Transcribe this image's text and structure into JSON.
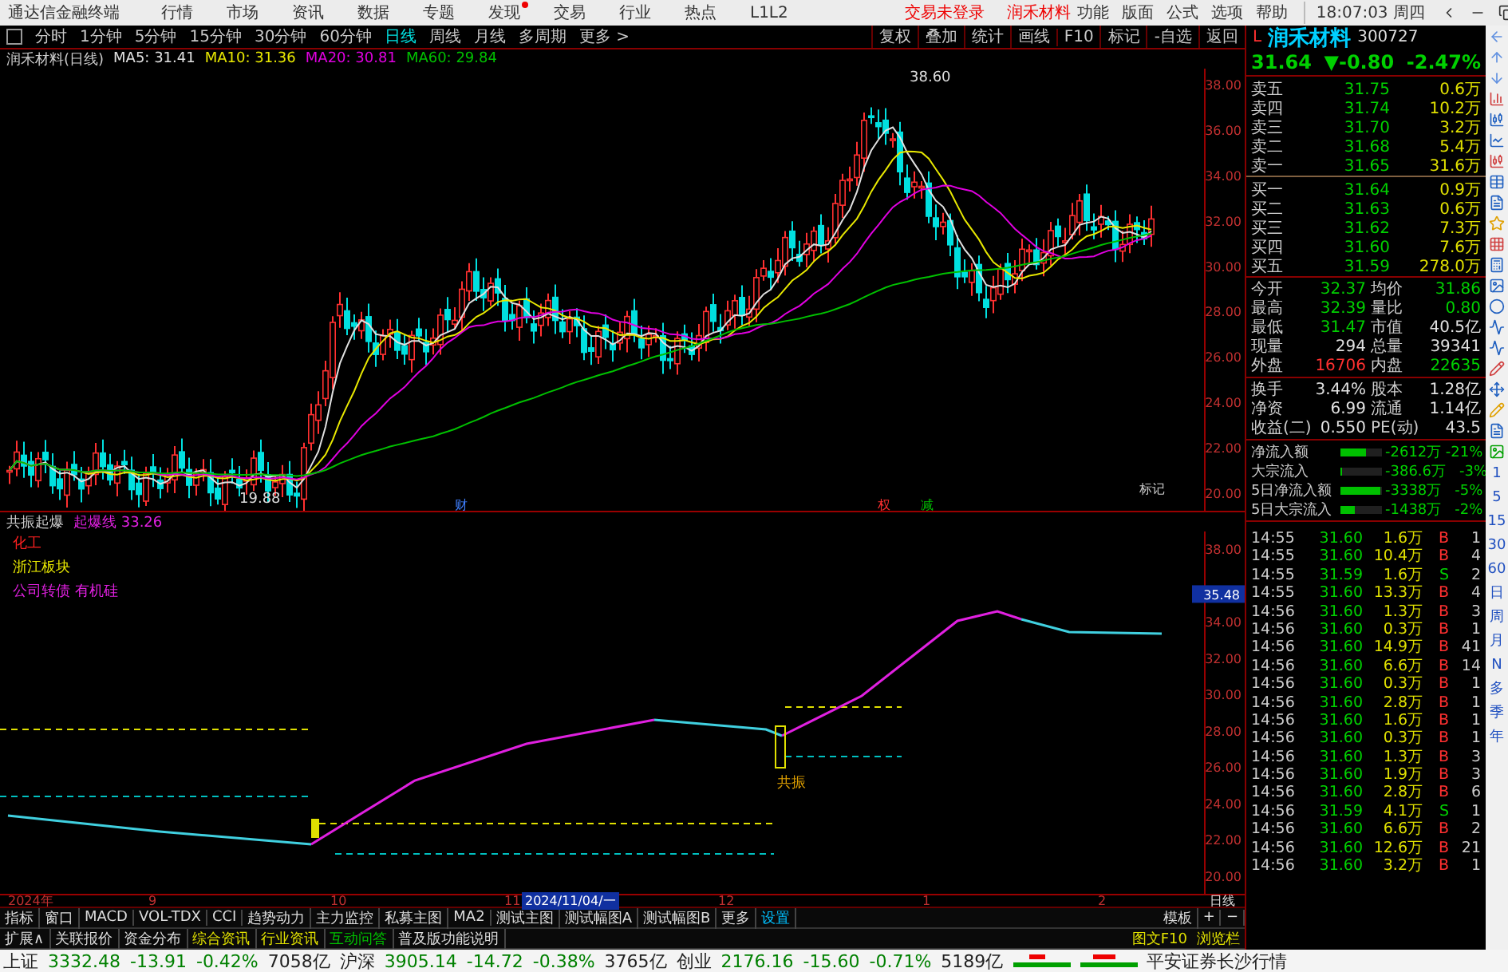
{
  "menu_bar": {
    "app_title": "通达信金融终端",
    "menus": [
      {
        "label": "行情",
        "dot": false
      },
      {
        "label": "市场",
        "dot": false
      },
      {
        "label": "资讯",
        "dot": false
      },
      {
        "label": "数据",
        "dot": false
      },
      {
        "label": "专题",
        "dot": false
      },
      {
        "label": "发现",
        "dot": true
      },
      {
        "label": "交易",
        "dot": false
      },
      {
        "label": "行业",
        "dot": false
      },
      {
        "label": "热点",
        "dot": false
      },
      {
        "label": "L1L2",
        "dot": false
      }
    ],
    "notices": [
      "交易未登录",
      "润禾材料"
    ],
    "tools": [
      "功能",
      "版面",
      "公式",
      "选项",
      "帮助"
    ],
    "clock": "18:07:03 周四"
  },
  "period_tabs": [
    {
      "label": "分时",
      "selected": false
    },
    {
      "label": "1分钟",
      "selected": false
    },
    {
      "label": "5分钟",
      "selected": false
    },
    {
      "label": "15分钟",
      "selected": false
    },
    {
      "label": "30分钟",
      "selected": false
    },
    {
      "label": "60分钟",
      "selected": false
    },
    {
      "label": "日线",
      "selected": true
    },
    {
      "label": "周线",
      "selected": false
    },
    {
      "label": "月线",
      "selected": false
    },
    {
      "label": "多周期",
      "selected": false
    },
    {
      "label": "更多 >",
      "selected": false
    }
  ],
  "chart_tools": [
    "复权",
    "叠加",
    "统计",
    "画线",
    "F10",
    "标记",
    "-自选",
    "返回"
  ],
  "main_chart": {
    "title": "润禾材料(日线)",
    "ma": [
      {
        "label": "MA5: 31.41",
        "color": "#e0e0e0"
      },
      {
        "label": "MA10: 31.36",
        "color": "#e8e800"
      },
      {
        "label": "MA20: 30.81",
        "color": "#e000e0"
      },
      {
        "label": "MA60: 29.84",
        "color": "#00c000"
      }
    ],
    "y_axis": [
      "38.00",
      "36.00",
      "34.00",
      "32.00",
      "30.00",
      "28.00",
      "26.00",
      "24.00",
      "22.00",
      "20.00"
    ],
    "high_label": "38.60",
    "low_label": "19.88",
    "marks": [
      {
        "text": "财",
        "color": "#4080ff"
      },
      {
        "text": "权",
        "color": "#ff3030"
      },
      {
        "text": "减",
        "color": "#00c000"
      }
    ],
    "tag": "标记"
  },
  "indicator": {
    "title": "共振起爆",
    "line_label": "起爆线 33.26",
    "notes": [
      {
        "text": "化工",
        "color": "#ff2020"
      },
      {
        "text": "浙江板块",
        "color": "#e8e800"
      },
      {
        "text": "公司转债 有机硅",
        "color": "#e020e0"
      }
    ],
    "signal_label": "共振",
    "y_axis": [
      "38.00",
      "34.00",
      "32.00",
      "30.00",
      "28.00",
      "26.00",
      "24.00",
      "22.00",
      "20.00"
    ],
    "current_value": "35.48"
  },
  "date_axis": {
    "labels": [
      "2024年",
      "9",
      "10",
      "11",
      "12",
      "1",
      "2"
    ],
    "cursor_date": "2024/11/04/一",
    "period": "日线"
  },
  "indicator_tabs": [
    {
      "label": "指标",
      "kind": "tab"
    },
    {
      "label": "窗口",
      "kind": "tab"
    },
    {
      "label": "MACD",
      "kind": "tab"
    },
    {
      "label": "VOL-TDX",
      "kind": "tab"
    },
    {
      "label": "CCI",
      "kind": "tab"
    },
    {
      "label": "趋势动力",
      "kind": "tab"
    },
    {
      "label": "主力监控",
      "kind": "tab"
    },
    {
      "label": "私募主图",
      "kind": "tab"
    },
    {
      "label": "MA2",
      "kind": "tab"
    },
    {
      "label": "测试主图",
      "kind": "tab"
    },
    {
      "label": "测试幅图A",
      "kind": "tab"
    },
    {
      "label": "测试幅图B",
      "kind": "tab"
    },
    {
      "label": "更多",
      "kind": "tab"
    },
    {
      "label": "设置",
      "kind": "link"
    }
  ],
  "template_controls": [
    "模板",
    "+",
    "−"
  ],
  "info_tabs": [
    {
      "label": "扩展∧",
      "kind": "tab"
    },
    {
      "label": "关联报价",
      "kind": "tab"
    },
    {
      "label": "资金分布",
      "kind": "tab"
    },
    {
      "label": "综合资讯",
      "kind": "news"
    },
    {
      "label": "行业资讯",
      "kind": "news"
    },
    {
      "label": "互动问答",
      "kind": "qa"
    },
    {
      "label": "普及版功能说明",
      "kind": "tab"
    }
  ],
  "side_buttons": [
    "图文F10",
    "浏览栏"
  ],
  "quote": {
    "prefix": "L",
    "name": "润禾材料",
    "code": "300727",
    "price": "31.64",
    "change": "▼-0.80",
    "percent": "-2.47%"
  },
  "order_book": {
    "asks": [
      {
        "label": "卖五",
        "price": "31.75",
        "volume": "0.6万"
      },
      {
        "label": "卖四",
        "price": "31.74",
        "volume": "10.2万"
      },
      {
        "label": "卖三",
        "price": "31.70",
        "volume": "3.2万"
      },
      {
        "label": "卖二",
        "price": "31.68",
        "volume": "5.4万"
      },
      {
        "label": "卖一",
        "price": "31.65",
        "volume": "31.6万"
      }
    ],
    "bids": [
      {
        "label": "买一",
        "price": "31.64",
        "volume": "0.9万"
      },
      {
        "label": "买二",
        "price": "31.63",
        "volume": "0.6万"
      },
      {
        "label": "买三",
        "price": "31.62",
        "volume": "7.3万"
      },
      {
        "label": "买四",
        "price": "31.60",
        "volume": "7.6万"
      },
      {
        "label": "买五",
        "price": "31.59",
        "volume": "278.0万"
      }
    ]
  },
  "stats": [
    {
      "label": "今开",
      "value": "32.37",
      "color": "#00d000"
    },
    {
      "label": "均价",
      "value": "31.86",
      "color": "#00d000"
    },
    {
      "label": "最高",
      "value": "32.39",
      "color": "#00d000"
    },
    {
      "label": "量比",
      "value": "0.80",
      "color": "#00d000"
    },
    {
      "label": "最低",
      "value": "31.47",
      "color": "#00d000"
    },
    {
      "label": "市值",
      "value": "40.5亿",
      "color": "#e0e0e0"
    },
    {
      "label": "现量",
      "value": "294",
      "color": "#e0e0e0"
    },
    {
      "label": "总量",
      "value": "39341",
      "color": "#e0e0e0"
    },
    {
      "label": "外盘",
      "value": "16706",
      "color": "#ff3030"
    },
    {
      "label": "内盘",
      "value": "22635",
      "color": "#00d000"
    }
  ],
  "stats2": [
    {
      "label": "换手",
      "value": "3.44%",
      "color": "#e0e0e0"
    },
    {
      "label": "股本",
      "value": "1.28亿",
      "color": "#e0e0e0"
    },
    {
      "label": "净资",
      "value": "6.99",
      "color": "#e0e0e0"
    },
    {
      "label": "流通",
      "value": "1.14亿",
      "color": "#e0e0e0"
    },
    {
      "label": "收益(二)",
      "value": "0.550",
      "color": "#e0e0e0"
    },
    {
      "label": "PE(动)",
      "value": "43.5",
      "color": "#e0e0e0"
    }
  ],
  "fund_flows": [
    {
      "label": "净流入额",
      "level": 0.6,
      "amount": "-2612万",
      "percent": "-21%"
    },
    {
      "label": "大宗流入",
      "level": 0.05,
      "amount": "-386.6万",
      "percent": "-3%"
    },
    {
      "label": "5日净流入额",
      "level": 0.95,
      "amount": "-3338万",
      "percent": "-5%"
    },
    {
      "label": "5日大宗流入",
      "level": 0.35,
      "amount": "-1438万",
      "percent": "-2%"
    }
  ],
  "ticks": [
    {
      "time": "14:55",
      "price": "31.60",
      "volume": "1.6万",
      "side": "B",
      "kind": "buy",
      "count": "1"
    },
    {
      "time": "14:55",
      "price": "31.60",
      "volume": "10.4万",
      "side": "B",
      "kind": "buy",
      "count": "4"
    },
    {
      "time": "14:55",
      "price": "31.59",
      "volume": "1.6万",
      "side": "S",
      "kind": "sell",
      "count": "2"
    },
    {
      "time": "14:55",
      "price": "31.60",
      "volume": "13.3万",
      "side": "B",
      "kind": "buy",
      "count": "4"
    },
    {
      "time": "14:56",
      "price": "31.60",
      "volume": "1.3万",
      "side": "B",
      "kind": "buy",
      "count": "3"
    },
    {
      "time": "14:56",
      "price": "31.60",
      "volume": "0.3万",
      "side": "B",
      "kind": "buy",
      "count": "1"
    },
    {
      "time": "14:56",
      "price": "31.60",
      "volume": "14.9万",
      "side": "B",
      "kind": "buy",
      "count": "41"
    },
    {
      "time": "14:56",
      "price": "31.60",
      "volume": "6.6万",
      "side": "B",
      "kind": "buy",
      "count": "14"
    },
    {
      "time": "14:56",
      "price": "31.60",
      "volume": "0.3万",
      "side": "B",
      "kind": "buy",
      "count": "1"
    },
    {
      "time": "14:56",
      "price": "31.60",
      "volume": "2.8万",
      "side": "B",
      "kind": "buy",
      "count": "1"
    },
    {
      "time": "14:56",
      "price": "31.60",
      "volume": "1.6万",
      "side": "B",
      "kind": "buy",
      "count": "1"
    },
    {
      "time": "14:56",
      "price": "31.60",
      "volume": "0.3万",
      "side": "B",
      "kind": "buy",
      "count": "1"
    },
    {
      "time": "14:56",
      "price": "31.60",
      "volume": "1.3万",
      "side": "B",
      "kind": "buy",
      "count": "3"
    },
    {
      "time": "14:56",
      "price": "31.60",
      "volume": "1.9万",
      "side": "B",
      "kind": "buy",
      "count": "3"
    },
    {
      "time": "14:56",
      "price": "31.60",
      "volume": "2.8万",
      "side": "B",
      "kind": "buy",
      "count": "6"
    },
    {
      "time": "14:56",
      "price": "31.59",
      "volume": "4.1万",
      "side": "S",
      "kind": "sell",
      "count": "1"
    },
    {
      "time": "14:56",
      "price": "31.60",
      "volume": "6.6万",
      "side": "B",
      "kind": "buy",
      "count": "2"
    },
    {
      "time": "14:56",
      "price": "31.60",
      "volume": "12.6万",
      "side": "B",
      "kind": "buy",
      "count": "21"
    },
    {
      "time": "14:56",
      "price": "31.60",
      "volume": "3.2万",
      "side": "B",
      "kind": "buy",
      "count": "1"
    }
  ],
  "period_strip": [
    "1",
    "5",
    "15",
    "30",
    "60",
    "日",
    "周",
    "月",
    "N",
    "多",
    "季",
    "年"
  ],
  "status_bar": {
    "indices": [
      {
        "name": "上证",
        "value": "3332.48",
        "change": "-13.91",
        "percent": "-0.42%",
        "turnover": "7058亿"
      },
      {
        "name": "沪深",
        "value": "3905.14",
        "change": "-14.72",
        "percent": "-0.38%",
        "turnover": "3765亿"
      },
      {
        "name": "创业",
        "value": "2176.16",
        "change": "-15.60",
        "percent": "-0.71%",
        "turnover": "5189亿"
      }
    ],
    "broker": "平安证券长沙行情"
  }
}
